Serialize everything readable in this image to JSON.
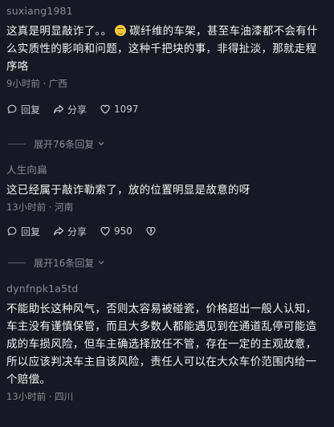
{
  "comments": [
    {
      "username": "suxiang1981",
      "text_before_emoji": "这真是明显敲诈了。。",
      "emoji": "smile-emoji",
      "text_after_emoji": "碳纤维的车架，甚至车油漆都不会有什么实质性的影响和问题，这种千把块的事，非得扯淡，那就走程序咯",
      "meta": "9小时前 · 广西",
      "reply_label": "回复",
      "share_label": "分享",
      "likes": "1097",
      "expand_label": "展开76条回复"
    },
    {
      "username": "人生向扁",
      "text": "这已经属于敲诈勒索了，放的位置明显是故意的呀",
      "meta": "13小时前 · 河南",
      "reply_label": "回复",
      "share_label": "分享",
      "likes": "950",
      "dislike_icon": "dislike-icon",
      "expand_label": "展开16条回复"
    },
    {
      "username": "dynfnpk1a5td",
      "text": "不能助长这种风气，否则太容易被碰瓷，价格超出一般人认知，车主没有谨慎保管，而且大多数人都能遇见到在通道乱停可能造成的车损风险，但车主确选择放任不管，存在一定的主观故意，所以应该判决车主自该风险，责任人可以在大众车价范围内给一个赔偿。",
      "meta": "13小时前 · 四川"
    }
  ],
  "colors": {
    "background": "#161823",
    "text": "#f2f3f5",
    "muted": "#8a8c94"
  }
}
